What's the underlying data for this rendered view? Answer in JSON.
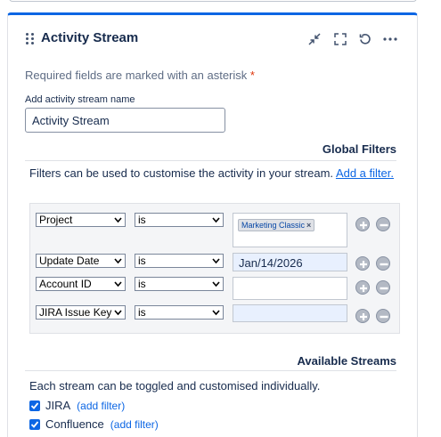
{
  "header": {
    "title": "Activity Stream",
    "icons": [
      "drag-handle-icon",
      "collapse-icon",
      "fullscreen-icon",
      "refresh-icon",
      "more-icon"
    ]
  },
  "form": {
    "required_note": "Required fields are marked with an asterisk",
    "required_star": "*",
    "name_label": "Add activity stream name",
    "name_value": "Activity Stream"
  },
  "global_filters": {
    "title": "Global Filters",
    "description": "Filters can be used to customise the activity in your stream.",
    "add_filter_link": "Add a filter.",
    "rows": [
      {
        "field": "Project",
        "operator": "is",
        "tag": "Marketing Classic",
        "value": ""
      },
      {
        "field": "Update Date",
        "operator": "is",
        "tag": "",
        "value": "Jan/14/2026"
      },
      {
        "field": "Account ID",
        "operator": "is",
        "tag": "",
        "value": ""
      },
      {
        "field": "JIRA Issue Key",
        "operator": "is",
        "tag": "",
        "value": ""
      }
    ],
    "tag_remove": "×"
  },
  "available_streams": {
    "title": "Available Streams",
    "description": "Each stream can be toggled and customised individually.",
    "streams": [
      {
        "name": "JIRA",
        "checked": true,
        "link": "(add filter)"
      },
      {
        "name": "Confluence",
        "checked": true,
        "link": "(add filter)"
      }
    ]
  },
  "colors": {
    "accent": "#0c66e4",
    "required": "#de350b",
    "text": "#172b4d",
    "filter_bg": "#f4f5f7"
  }
}
